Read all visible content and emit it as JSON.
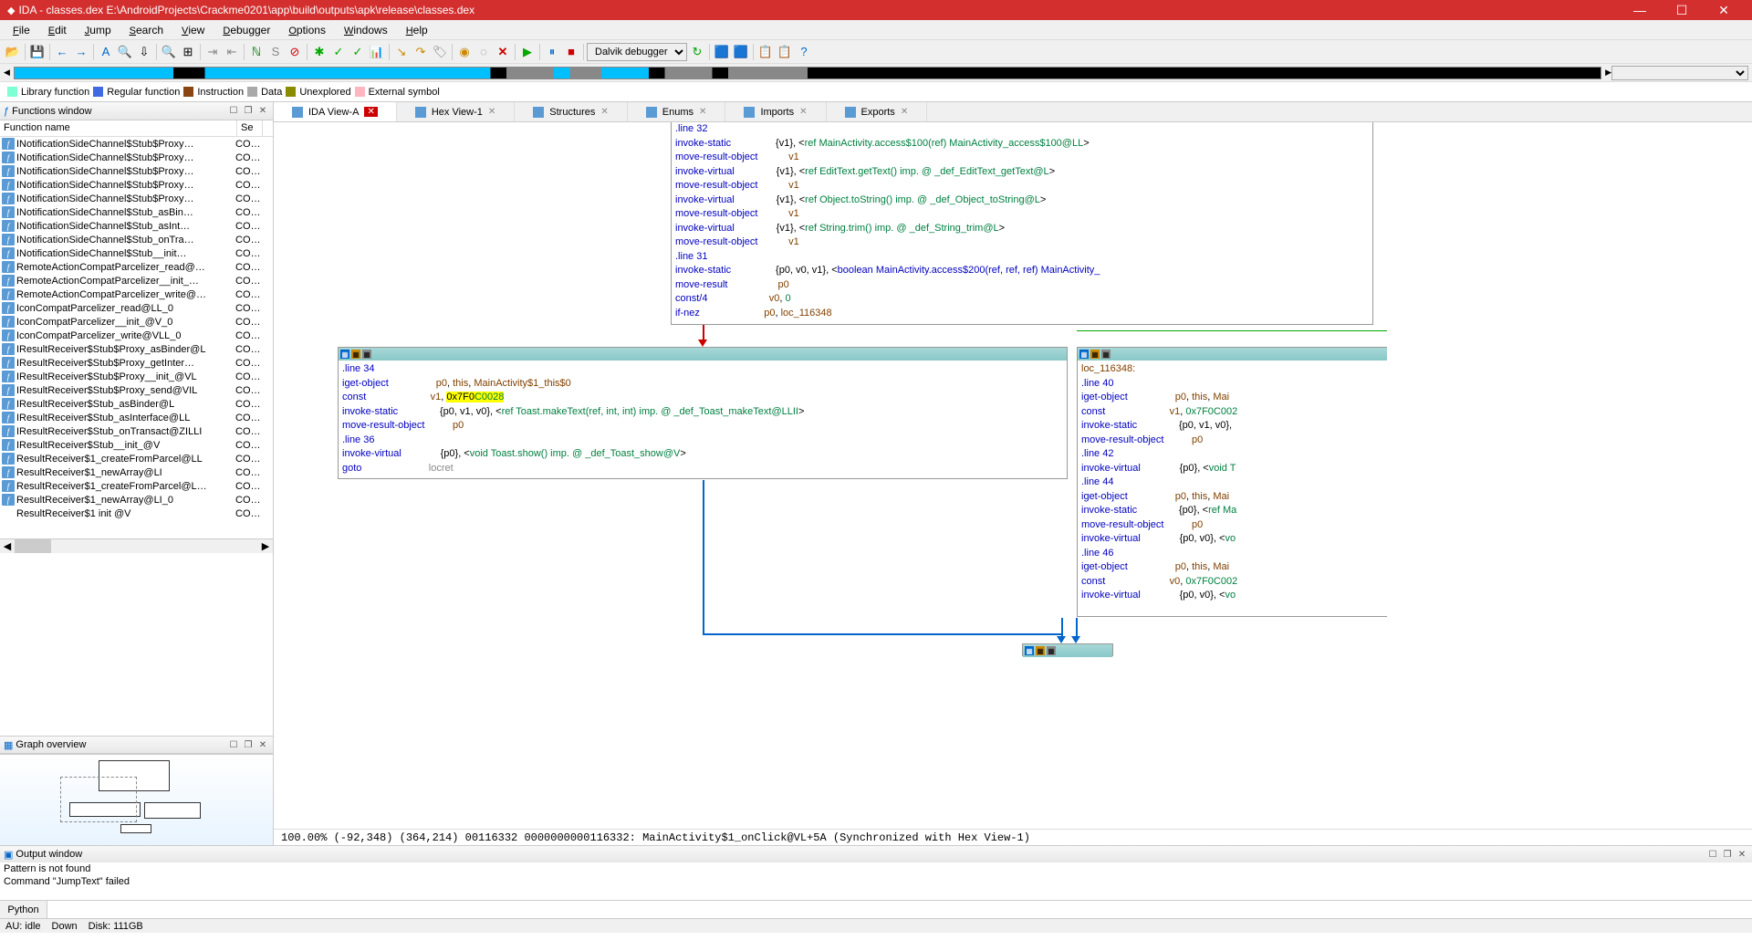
{
  "title": "IDA - classes.dex E:\\AndroidProjects\\Crackme0201\\app\\build\\outputs\\apk\\release\\classes.dex",
  "menus": [
    "File",
    "Edit",
    "Jump",
    "Search",
    "View",
    "Debugger",
    "Options",
    "Windows",
    "Help"
  ],
  "debugger_select": "Dalvik debugger",
  "legend": [
    {
      "color": "#7fffd4",
      "label": "Library function"
    },
    {
      "color": "#4169e1",
      "label": "Regular function"
    },
    {
      "color": "#8b4513",
      "label": "Instruction"
    },
    {
      "color": "#a9a9a9",
      "label": "Data"
    },
    {
      "color": "#8b8b00",
      "label": "Unexplored"
    },
    {
      "color": "#ffb6c1",
      "label": "External symbol"
    }
  ],
  "functions_panel": {
    "title": "Functions window",
    "cols": [
      "Function name",
      "Se"
    ],
    "rows": [
      {
        "name": "INotificationSideChannel$Stub$Proxy…",
        "seg": "CO…"
      },
      {
        "name": "INotificationSideChannel$Stub$Proxy…",
        "seg": "CO…"
      },
      {
        "name": "INotificationSideChannel$Stub$Proxy…",
        "seg": "CO…"
      },
      {
        "name": "INotificationSideChannel$Stub$Proxy…",
        "seg": "CO…"
      },
      {
        "name": "INotificationSideChannel$Stub$Proxy…",
        "seg": "CO…"
      },
      {
        "name": "INotificationSideChannel$Stub_asBin…",
        "seg": "CO…"
      },
      {
        "name": "INotificationSideChannel$Stub_asInt…",
        "seg": "CO…"
      },
      {
        "name": "INotificationSideChannel$Stub_onTra…",
        "seg": "CO…"
      },
      {
        "name": "INotificationSideChannel$Stub__init…",
        "seg": "CO…"
      },
      {
        "name": "RemoteActionCompatParcelizer_read@…",
        "seg": "CO…"
      },
      {
        "name": "RemoteActionCompatParcelizer__init_…",
        "seg": "CO…"
      },
      {
        "name": "RemoteActionCompatParcelizer_write@…",
        "seg": "CO…"
      },
      {
        "name": "IconCompatParcelizer_read@LL_0",
        "seg": "CO…"
      },
      {
        "name": "IconCompatParcelizer__init_@V_0",
        "seg": "CO…"
      },
      {
        "name": "IconCompatParcelizer_write@VLL_0",
        "seg": "CO…"
      },
      {
        "name": "IResultReceiver$Stub$Proxy_asBinder@L",
        "seg": "CO…"
      },
      {
        "name": "IResultReceiver$Stub$Proxy_getInter…",
        "seg": "CO…"
      },
      {
        "name": "IResultReceiver$Stub$Proxy__init_@VL",
        "seg": "CO…"
      },
      {
        "name": "IResultReceiver$Stub$Proxy_send@VIL",
        "seg": "CO…"
      },
      {
        "name": "IResultReceiver$Stub_asBinder@L",
        "seg": "CO…"
      },
      {
        "name": "IResultReceiver$Stub_asInterface@LL",
        "seg": "CO…"
      },
      {
        "name": "IResultReceiver$Stub_onTransact@ZILLI",
        "seg": "CO…"
      },
      {
        "name": "IResultReceiver$Stub__init_@V",
        "seg": "CO…"
      },
      {
        "name": "ResultReceiver$1_createFromParcel@LL",
        "seg": "CO…"
      },
      {
        "name": "ResultReceiver$1_newArray@LI",
        "seg": "CO…"
      },
      {
        "name": "ResultReceiver$1_createFromParcel@L…",
        "seg": "CO…"
      },
      {
        "name": "ResultReceiver$1_newArray@LI_0",
        "seg": "CO…"
      },
      {
        "name": "ResultReceiver$1  init @V",
        "seg": "CO…",
        "noicon": true
      }
    ]
  },
  "graph_panel": {
    "title": "Graph overview"
  },
  "tabs": [
    {
      "label": "IDA View-A",
      "active": true,
      "close_red": true
    },
    {
      "label": "Hex View-1"
    },
    {
      "label": "Structures"
    },
    {
      "label": "Enums"
    },
    {
      "label": "Imports"
    },
    {
      "label": "Exports"
    }
  ],
  "node_top": {
    "lines": [
      [
        {
          "t": ".line 32",
          "c": "blue"
        }
      ],
      [
        {
          "t": "invoke-static",
          "c": "blue"
        },
        {
          "sp": 16
        },
        {
          "t": "{v1}, <",
          "c": ""
        },
        {
          "t": "ref MainActivity.access$100(ref) MainActivity_access$100@LL",
          "c": "green"
        },
        {
          "t": ">"
        }
      ],
      [
        {
          "t": "move-result-object",
          "c": "blue"
        },
        {
          "sp": 11
        },
        {
          "t": "v1",
          "c": "brown"
        }
      ],
      [
        {
          "t": "invoke-virtual",
          "c": "blue"
        },
        {
          "sp": 15
        },
        {
          "t": "{v1}, <",
          "c": ""
        },
        {
          "t": "ref EditText.getText() imp. @ _def_EditText_getText@L",
          "c": "green"
        },
        {
          "t": ">"
        }
      ],
      [
        {
          "t": "move-result-object",
          "c": "blue"
        },
        {
          "sp": 11
        },
        {
          "t": "v1",
          "c": "brown"
        }
      ],
      [
        {
          "t": "invoke-virtual",
          "c": "blue"
        },
        {
          "sp": 15
        },
        {
          "t": "{v1}, <",
          "c": ""
        },
        {
          "t": "ref Object.toString() imp. @ _def_Object_toString@L",
          "c": "green"
        },
        {
          "t": ">"
        }
      ],
      [
        {
          "t": "move-result-object",
          "c": "blue"
        },
        {
          "sp": 11
        },
        {
          "t": "v1",
          "c": "brown"
        }
      ],
      [
        {
          "t": "invoke-virtual",
          "c": "blue"
        },
        {
          "sp": 15
        },
        {
          "t": "{v1}, <",
          "c": ""
        },
        {
          "t": "ref String.trim() imp. @ _def_String_trim@L",
          "c": "green"
        },
        {
          "t": ">"
        }
      ],
      [
        {
          "t": "move-result-object",
          "c": "blue"
        },
        {
          "sp": 11
        },
        {
          "t": "v1",
          "c": "brown"
        }
      ],
      [
        {
          "t": ".line 31",
          "c": "blue"
        }
      ],
      [
        {
          "t": "invoke-static",
          "c": "blue"
        },
        {
          "sp": 16
        },
        {
          "t": "{p0, v0, v1}, <",
          "c": ""
        },
        {
          "t": "boolean MainActivity.access$200(ref, ref, ref) MainActivity_",
          "c": "blue"
        }
      ],
      [
        {
          "t": "move-result",
          "c": "blue"
        },
        {
          "sp": 18
        },
        {
          "t": "p0",
          "c": "brown"
        }
      ],
      [
        {
          "t": "const/4",
          "c": "blue"
        },
        {
          "sp": 22
        },
        {
          "t": "v0",
          "c": "brown"
        },
        {
          "t": ", "
        },
        {
          "t": "0",
          "c": "green"
        }
      ],
      [
        {
          "t": "if-nez",
          "c": "blue"
        },
        {
          "sp": 23
        },
        {
          "t": "p0",
          "c": "brown"
        },
        {
          "t": ", "
        },
        {
          "t": "loc_116348",
          "c": "brown"
        }
      ]
    ]
  },
  "node_mid": {
    "lines": [
      [
        {
          "t": ".line 34",
          "c": "blue"
        }
      ],
      [
        {
          "t": "iget-object",
          "c": "blue"
        },
        {
          "sp": 17
        },
        {
          "t": "p0",
          "c": "brown"
        },
        {
          "t": ", "
        },
        {
          "t": "this",
          "c": "brown"
        },
        {
          "t": ", "
        },
        {
          "t": "MainActivity$1_this$0",
          "c": "brown"
        }
      ],
      [
        {
          "t": "const",
          "c": "blue"
        },
        {
          "sp": 23
        },
        {
          "t": "v1",
          "c": "brown"
        },
        {
          "t": ", "
        },
        {
          "t": "0x7F",
          "hl": true
        },
        {
          "t": "0",
          "hl": true
        },
        {
          "t": "C0028",
          "hl": true,
          "c": "green"
        }
      ],
      [
        {
          "t": "invoke-static",
          "c": "blue"
        },
        {
          "sp": 15
        },
        {
          "t": "{p0, v1, v0}, <",
          "c": ""
        },
        {
          "t": "ref Toast.makeText(ref, int, int) imp. @ _def_Toast_makeText@LLII",
          "c": "green"
        },
        {
          "t": ">"
        }
      ],
      [
        {
          "t": "move-result-object",
          "c": "blue"
        },
        {
          "sp": 10
        },
        {
          "t": "p0",
          "c": "brown"
        }
      ],
      [
        {
          "t": ".line 36",
          "c": "blue"
        }
      ],
      [
        {
          "t": "invoke-virtual",
          "c": "blue"
        },
        {
          "sp": 14
        },
        {
          "t": "{p0}, <",
          "c": ""
        },
        {
          "t": "void Toast.show() imp. @ _def_Toast_show@V",
          "c": "green"
        },
        {
          "t": ">"
        }
      ],
      [
        {
          "t": "goto",
          "c": "blue"
        },
        {
          "sp": 24
        },
        {
          "t": "locret",
          "c": "gray"
        }
      ]
    ]
  },
  "node_right": {
    "lines": [
      [
        {
          "t": "loc_116348:",
          "c": "brown"
        }
      ],
      [
        {
          "t": ".line 40",
          "c": "blue"
        }
      ],
      [
        {
          "t": "iget-object",
          "c": "blue"
        },
        {
          "sp": 17
        },
        {
          "t": "p0",
          "c": "brown"
        },
        {
          "t": ", "
        },
        {
          "t": "this",
          "c": "brown"
        },
        {
          "t": ", "
        },
        {
          "t": "Mai",
          "c": "brown"
        }
      ],
      [
        {
          "t": "const",
          "c": "blue"
        },
        {
          "sp": 23
        },
        {
          "t": "v1",
          "c": "brown"
        },
        {
          "t": ", "
        },
        {
          "t": "0x7F0C002",
          "c": "green"
        }
      ],
      [
        {
          "t": "invoke-static",
          "c": "blue"
        },
        {
          "sp": 15
        },
        {
          "t": "{p0, v1, v0},"
        }
      ],
      [
        {
          "t": "move-result-object",
          "c": "blue"
        },
        {
          "sp": 10
        },
        {
          "t": "p0",
          "c": "brown"
        }
      ],
      [
        {
          "t": ".line 42",
          "c": "blue"
        }
      ],
      [
        {
          "t": "invoke-virtual",
          "c": "blue"
        },
        {
          "sp": 14
        },
        {
          "t": "{p0}, <",
          "c": ""
        },
        {
          "t": "void T",
          "c": "green"
        }
      ],
      [
        {
          "t": ".line 44",
          "c": "blue"
        }
      ],
      [
        {
          "t": "iget-object",
          "c": "blue"
        },
        {
          "sp": 17
        },
        {
          "t": "p0",
          "c": "brown"
        },
        {
          "t": ", "
        },
        {
          "t": "this",
          "c": "brown"
        },
        {
          "t": ", "
        },
        {
          "t": "Mai",
          "c": "brown"
        }
      ],
      [
        {
          "t": "invoke-static",
          "c": "blue"
        },
        {
          "sp": 15
        },
        {
          "t": "{p0}, <",
          "c": ""
        },
        {
          "t": "ref Ma",
          "c": "green"
        }
      ],
      [
        {
          "t": "move-result-object",
          "c": "blue"
        },
        {
          "sp": 10
        },
        {
          "t": "p0",
          "c": "brown"
        }
      ],
      [
        {
          "t": "invoke-virtual",
          "c": "blue"
        },
        {
          "sp": 14
        },
        {
          "t": "{p0, v0}, <",
          "c": ""
        },
        {
          "t": "vo",
          "c": "green"
        }
      ],
      [
        {
          "t": ".line 46",
          "c": "blue"
        }
      ],
      [
        {
          "t": "iget-object",
          "c": "blue"
        },
        {
          "sp": 17
        },
        {
          "t": "p0",
          "c": "brown"
        },
        {
          "t": ", "
        },
        {
          "t": "this",
          "c": "brown"
        },
        {
          "t": ", "
        },
        {
          "t": "Mai",
          "c": "brown"
        }
      ],
      [
        {
          "t": "const",
          "c": "blue"
        },
        {
          "sp": 23
        },
        {
          "t": "v0",
          "c": "brown"
        },
        {
          "t": ", "
        },
        {
          "t": "0x7F0C002",
          "c": "green"
        }
      ],
      [
        {
          "t": "invoke-virtual",
          "c": "blue"
        },
        {
          "sp": 14
        },
        {
          "t": "{p0, v0}, <",
          "c": ""
        },
        {
          "t": "vo",
          "c": "green"
        }
      ]
    ]
  },
  "status_line": "100.00% (-92,348) (364,214) 00116332 0000000000116332: MainActivity$1_onClick@VL+5A (Synchronized with Hex View-1)",
  "output_panel": {
    "title": "Output window",
    "lines": [
      "Pattern is not found",
      "Command \"JumpText\" failed"
    ]
  },
  "python_label": "Python",
  "statusbar": {
    "au": "AU:  idle",
    "down": "Down",
    "disk": "Disk: 111GB"
  }
}
